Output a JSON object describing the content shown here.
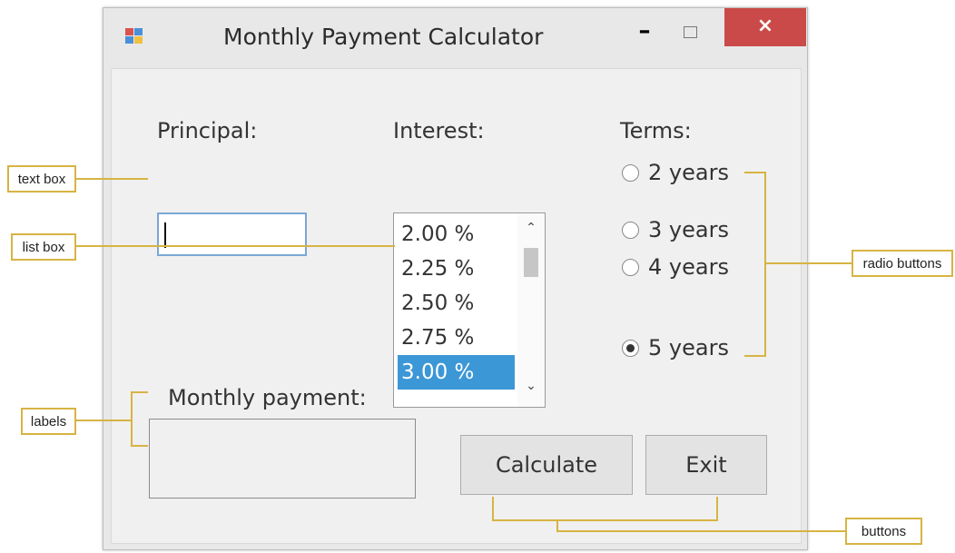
{
  "window": {
    "title": "Monthly Payment Calculator",
    "minimize_glyph": "–",
    "close_glyph": "×"
  },
  "form": {
    "principal_label": "Principal:",
    "principal_value": "",
    "interest_label": "Interest:",
    "interest_options": [
      "2.00 %",
      "2.25 %",
      "2.50 %",
      "2.75 %",
      "3.00 %"
    ],
    "interest_selected": "3.00 %",
    "terms_label": "Terms:",
    "terms": [
      {
        "label": "2 years",
        "checked": false
      },
      {
        "label": "3 years",
        "checked": false
      },
      {
        "label": "4 years",
        "checked": false
      },
      {
        "label": "5 years",
        "checked": true
      }
    ],
    "monthly_payment_label": "Monthly payment:",
    "monthly_payment_value": "",
    "calculate_label": "Calculate",
    "exit_label": "Exit"
  },
  "callouts": {
    "text_box": "text box",
    "list_box": "list box",
    "labels": "labels",
    "radio_buttons": "radio buttons",
    "buttons": "buttons"
  },
  "colors": {
    "close_button": "#c94a48",
    "selection": "#3c97d6",
    "callout_line": "#d7b443"
  }
}
